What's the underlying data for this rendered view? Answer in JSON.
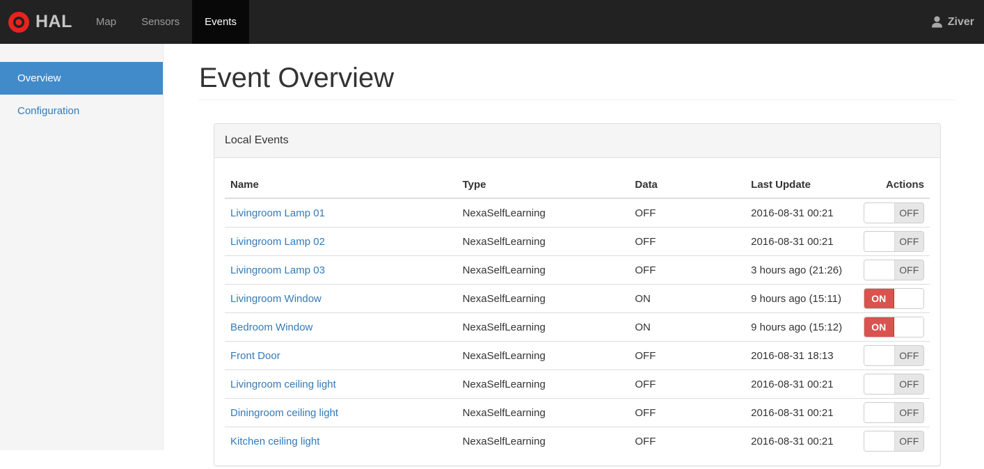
{
  "navbar": {
    "brand": "HAL",
    "items": [
      {
        "label": "Map",
        "active": false
      },
      {
        "label": "Sensors",
        "active": false
      },
      {
        "label": "Events",
        "active": true
      }
    ],
    "user": {
      "name": "Ziver",
      "icon": "user-icon"
    }
  },
  "sidebar": {
    "items": [
      {
        "label": "Overview",
        "active": true
      },
      {
        "label": "Configuration",
        "active": false
      }
    ]
  },
  "page": {
    "title": "Event Overview"
  },
  "local_events": {
    "title": "Local Events",
    "columns": [
      "Name",
      "Type",
      "Data",
      "Last Update",
      "Actions"
    ],
    "rows": [
      {
        "name": "Livingroom Lamp 01",
        "type": "NexaSelfLearning",
        "data": "OFF",
        "last_update": "2016-08-31 00:21",
        "switch": "OFF"
      },
      {
        "name": "Livingroom Lamp 02",
        "type": "NexaSelfLearning",
        "data": "OFF",
        "last_update": "2016-08-31 00:21",
        "switch": "OFF"
      },
      {
        "name": "Livingroom Lamp 03",
        "type": "NexaSelfLearning",
        "data": "OFF",
        "last_update": "3 hours ago (21:26)",
        "switch": "OFF"
      },
      {
        "name": "Livingroom Window",
        "type": "NexaSelfLearning",
        "data": "ON",
        "last_update": "9 hours ago (15:11)",
        "switch": "ON"
      },
      {
        "name": "Bedroom Window",
        "type": "NexaSelfLearning",
        "data": "ON",
        "last_update": "9 hours ago (15:12)",
        "switch": "ON"
      },
      {
        "name": "Front Door",
        "type": "NexaSelfLearning",
        "data": "OFF",
        "last_update": "2016-08-31 18:13",
        "switch": "OFF"
      },
      {
        "name": "Livingroom ceiling light",
        "type": "NexaSelfLearning",
        "data": "OFF",
        "last_update": "2016-08-31 00:21",
        "switch": "OFF"
      },
      {
        "name": "Diningroom ceiling light",
        "type": "NexaSelfLearning",
        "data": "OFF",
        "last_update": "2016-08-31 00:21",
        "switch": "OFF"
      },
      {
        "name": "Kitchen ceiling light",
        "type": "NexaSelfLearning",
        "data": "OFF",
        "last_update": "2016-08-31 00:21",
        "switch": "OFF"
      }
    ]
  },
  "colors": {
    "navbar_bg": "#222222",
    "navbar_active_bg": "#080808",
    "sidebar_active_blue": "#428bca",
    "link_blue": "#337ab7",
    "switch_on_red": "#d9534f",
    "logo_red": "#e8231d"
  }
}
